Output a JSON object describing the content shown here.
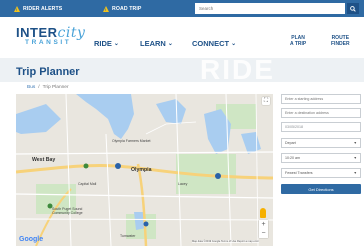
{
  "topbar": {
    "rider_alerts": "RIDER ALERTS",
    "road_trip": "ROAD TRIP",
    "search_placeholder": "Search"
  },
  "header": {
    "logo_top_a": "INTER",
    "logo_top_b": "city",
    "logo_bottom": "TRANSIT",
    "nav": [
      "RIDE",
      "LEARN",
      "CONNECT"
    ],
    "plan_trip_1": "PLAN",
    "plan_trip_2": "A TRIP",
    "route_finder_1": "ROUTE",
    "route_finder_2": "FINDER"
  },
  "banner": {
    "title": "Trip Planner",
    "watermark": "RIDE"
  },
  "breadcrumb": [
    "Bus",
    "/",
    "Trip Planner"
  ],
  "map": {
    "labels": {
      "olympia": "Olympia",
      "tumwater": "Tumwater",
      "lacey": "Lacey",
      "capital_mall": "Capital Mall",
      "south_puget": "South Puget Sound Community College",
      "farmers_market": "Olympia Farmers Market",
      "west_bay": "West Bay"
    },
    "google": "Google",
    "attribution": "Map data ©2019 Google   Terms of Use   Report a map error"
  },
  "form": {
    "start_placeholder": "Enter a starting address",
    "dest_placeholder": "Enter a destination address",
    "date": "03/05/2018",
    "mode": "Depart",
    "time": "10:20 am",
    "preference": "Fewest Transfers",
    "submit": "Get Directions"
  },
  "colors": {
    "brand_blue": "#1e5187",
    "bar_blue": "#2f6aa3",
    "accent_yellow": "#f2c21b"
  }
}
